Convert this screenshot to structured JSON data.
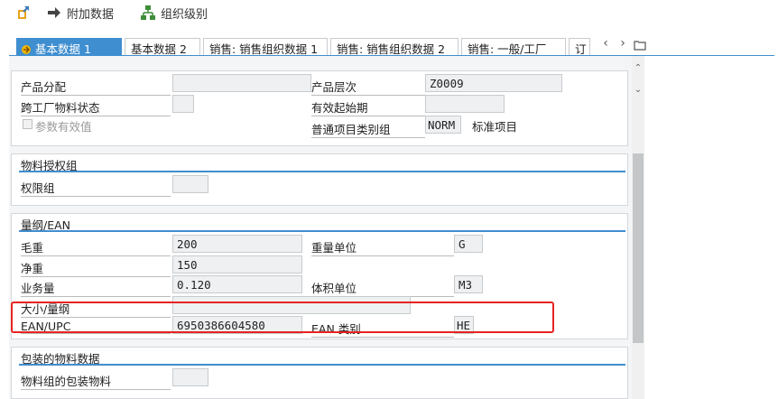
{
  "toolbar": {
    "additional_data_label": "附加数据",
    "org_levels_label": "组织级别"
  },
  "tabs": [
    {
      "label": "基本数据 1"
    },
    {
      "label": "基本数据 2"
    },
    {
      "label": "销售: 销售组织数据 1"
    },
    {
      "label": "销售: 销售组织数据 2"
    },
    {
      "label": "销售: 一般/工厂"
    },
    {
      "label": "订"
    }
  ],
  "general": {
    "product_allocation_label": "产品分配",
    "product_allocation_value": "",
    "product_hierarchy_label": "产品层次",
    "product_hierarchy_value": "Z0009",
    "cross_plant_status_label": "跨工厂物料状态",
    "cross_plant_status_value": "",
    "valid_from_label": "有效起始期",
    "valid_from_value": "",
    "param_effectivity_label": "参数有效值",
    "item_category_group_label": "普通项目类别组",
    "item_category_group_value": "NORM",
    "item_category_group_desc": "标准项目"
  },
  "authorization": {
    "title": "物料授权组",
    "auth_group_label": "权限组",
    "auth_group_value": ""
  },
  "dimensions": {
    "title": "量纲/EAN",
    "gross_weight_label": "毛重",
    "gross_weight_value": "200",
    "weight_unit_label": "重量单位",
    "weight_unit_value": "G",
    "net_weight_label": "净重",
    "net_weight_value": "150",
    "volume_label": "业务量",
    "volume_value": "0.120",
    "volume_unit_label": "体积单位",
    "volume_unit_value": "M3",
    "size_dim_label": "大小/量纲",
    "size_dim_value": "",
    "ean_label": "EAN/UPC",
    "ean_value": "6950386604580",
    "ean_category_label": "EAN 类别",
    "ean_category_value": "HE"
  },
  "packaging": {
    "title": "包装的物料数据",
    "mat_group_pack_label": "物料组的包装物料",
    "mat_group_pack_value": ""
  },
  "colors": {
    "accent": "#3f8ed0",
    "highlight": "#e52421"
  }
}
